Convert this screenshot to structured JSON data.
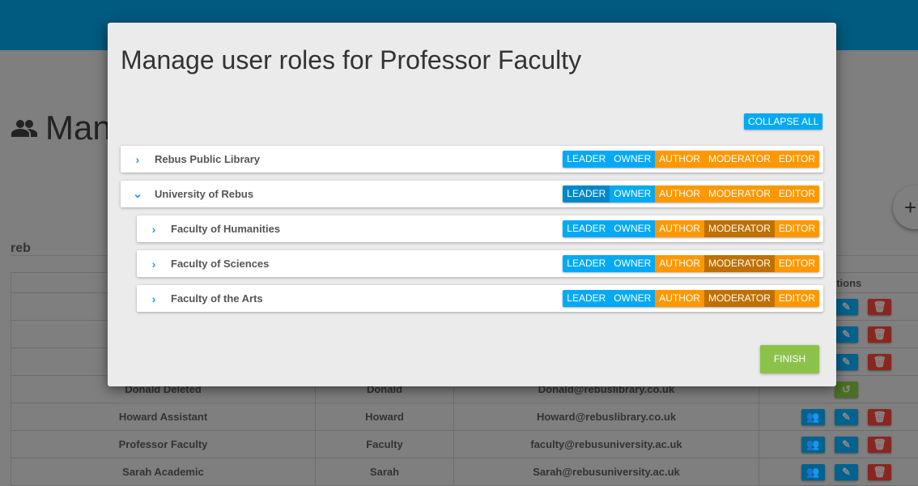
{
  "background": {
    "page_title": "Man",
    "add_button": "+",
    "filter_text": "reb",
    "actions_header": "ctions",
    "rows": [
      {
        "name": "",
        "username": "",
        "email": "",
        "actions": [
          "edit",
          "delete"
        ]
      },
      {
        "name": "",
        "username": "",
        "email": "",
        "actions": [
          "edit",
          "delete"
        ]
      },
      {
        "name": "",
        "username": "",
        "email": "",
        "actions": [
          "edit",
          "delete"
        ]
      },
      {
        "name": "Donald Deleted",
        "username": "Donald",
        "email": "Donald@rebuslibrary.co.uk",
        "actions": [
          "restore"
        ]
      },
      {
        "name": "Howard Assistant",
        "username": "Howard",
        "email": "Howard@rebuslibrary.co.uk",
        "actions": [
          "roles",
          "edit",
          "delete"
        ]
      },
      {
        "name": "Professor Faculty",
        "username": "Faculty",
        "email": "faculty@rebusuniversity.ac.uk",
        "actions": [
          "roles",
          "edit",
          "delete"
        ]
      },
      {
        "name": "Sarah Academic",
        "username": "Sarah",
        "email": "Sarah@rebusuniversity.ac.uk",
        "actions": [
          "roles",
          "edit",
          "delete"
        ]
      }
    ]
  },
  "modal": {
    "title": "Manage user roles for Professor Faculty",
    "collapse_all": "COLLAPSE ALL",
    "finish": "FINISH",
    "role_labels": [
      "LEADER",
      "OWNER",
      "AUTHOR",
      "MODERATOR",
      "EDITOR"
    ],
    "organisations": [
      {
        "name": "Rebus Public Library",
        "expanded": false,
        "level": 0,
        "active_roles": []
      },
      {
        "name": "University of Rebus",
        "expanded": true,
        "level": 0,
        "active_roles": [
          "LEADER"
        ]
      },
      {
        "name": "Faculty of Humanities",
        "expanded": false,
        "level": 1,
        "active_roles": [
          "MODERATOR"
        ]
      },
      {
        "name": "Faculty of Sciences",
        "expanded": false,
        "level": 1,
        "active_roles": [
          "MODERATOR"
        ]
      },
      {
        "name": "Faculty of the Arts",
        "expanded": false,
        "level": 1,
        "active_roles": [
          "MODERATOR"
        ]
      }
    ]
  },
  "colors": {
    "leader_owner": "#03a9f4",
    "author_moderator_editor": "#ff9800",
    "finish": "#8bc34a",
    "topbar": "#0288d1"
  }
}
